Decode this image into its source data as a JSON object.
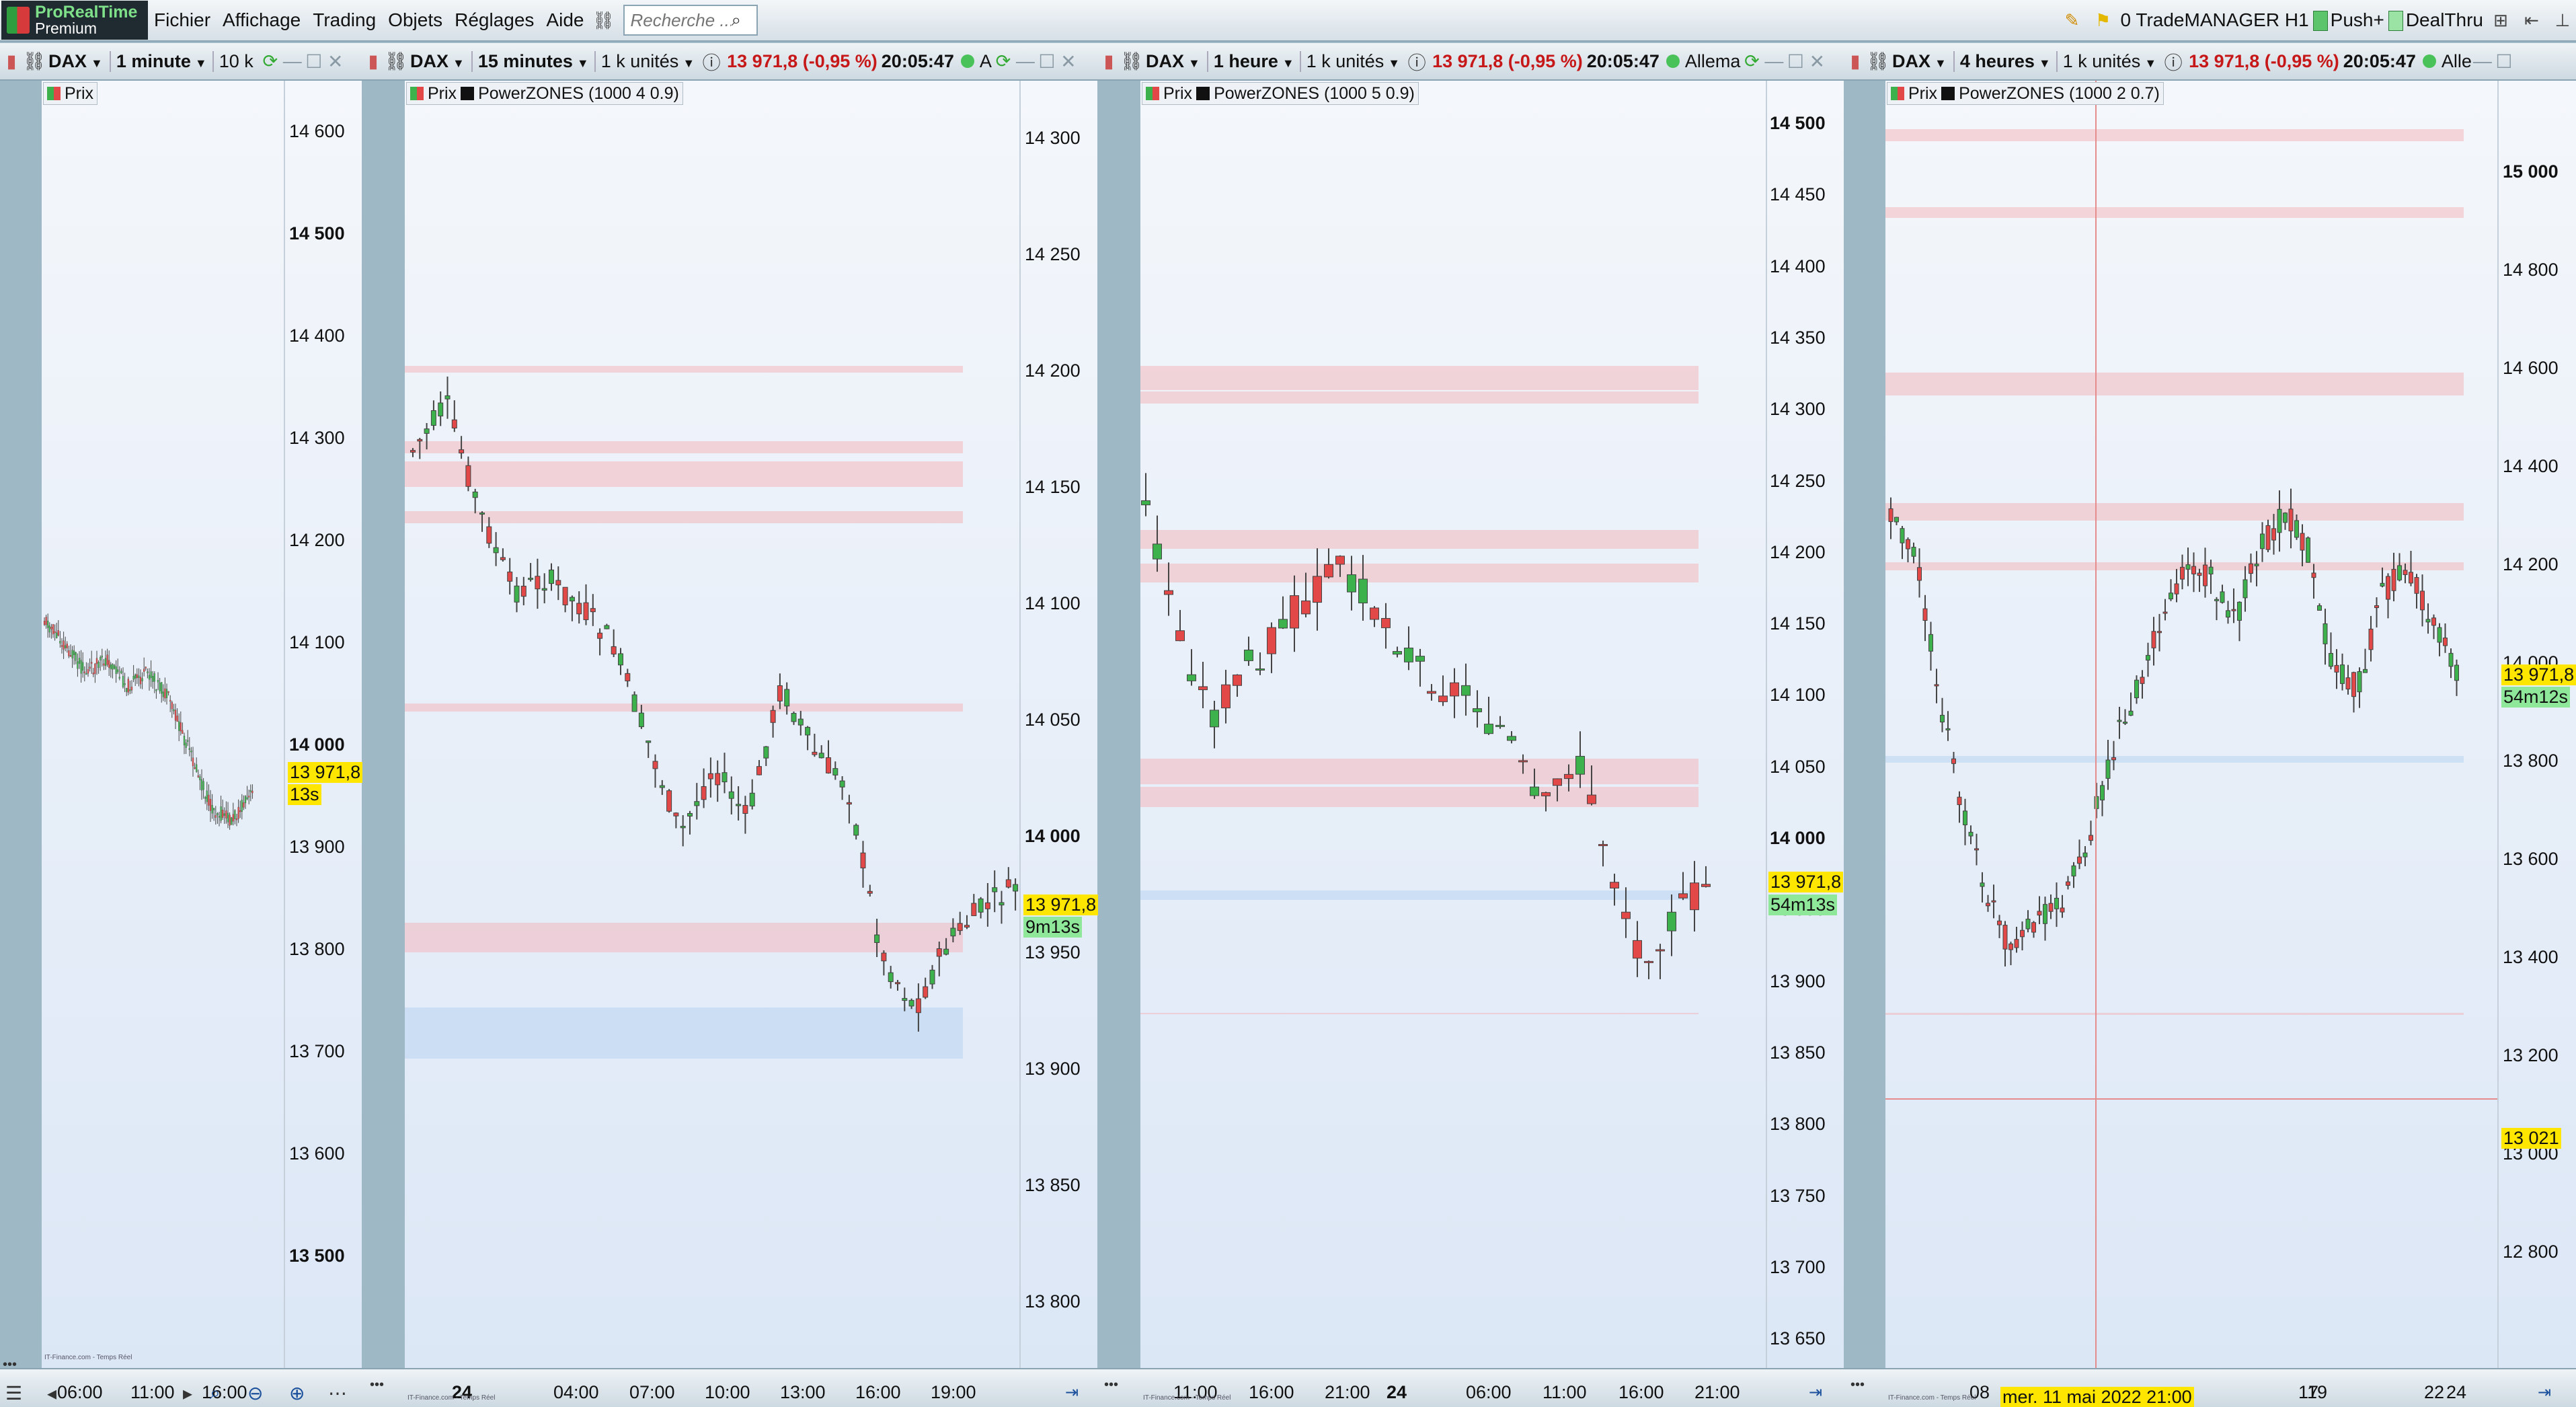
{
  "app": {
    "logo_line1": "ProRealTime",
    "logo_line2": "Premium"
  },
  "menu": [
    "Fichier",
    "Affichage",
    "Trading",
    "Objets",
    "Réglages",
    "Aide"
  ],
  "search": {
    "placeholder": "Recherche ..."
  },
  "topright": {
    "orders": "0 TradeMANAGER H1",
    "push": "Push+",
    "dealthru": "DealThru"
  },
  "source": "IT-Finance.com - Temps Réel",
  "panels": [
    {
      "symbol": "DAX",
      "timeframe": "1 minute",
      "units": "10 k",
      "legend": [
        "Prix"
      ],
      "yticks": [
        "14 600",
        "14 500",
        "14 400",
        "14 300",
        "14 200",
        "14 100",
        "14 000",
        "13 900",
        "13 800",
        "13 700",
        "13 600",
        "13 500"
      ],
      "price_label": "13 971,8",
      "countdown": "13s",
      "xticks": [
        "06:00",
        "11:00",
        "16:00"
      ]
    },
    {
      "symbol": "DAX",
      "timeframe": "15 minutes",
      "units": "1 k unités",
      "price": "13 971,8 (-0,95 %)",
      "time": "20:05:47",
      "market": "A",
      "legend": [
        "Prix",
        "PowerZONES (1000 4 0.9)"
      ],
      "yticks": [
        "14 300",
        "14 250",
        "14 200",
        "14 150",
        "14 100",
        "14 050",
        "14 000",
        "13 950",
        "13 900",
        "13 850",
        "13 800"
      ],
      "price_label": "13 971,8",
      "countdown": "9m13s",
      "xticks": [
        "24",
        "04:00",
        "07:00",
        "10:00",
        "13:00",
        "16:00",
        "19:00"
      ]
    },
    {
      "symbol": "DAX",
      "timeframe": "1 heure",
      "units": "1 k unités",
      "price": "13 971,8 (-0,95 %)",
      "time": "20:05:47",
      "market": "Allema",
      "legend": [
        "Prix",
        "PowerZONES (1000 5 0.9)"
      ],
      "yticks": [
        "14 500",
        "14 450",
        "14 400",
        "14 350",
        "14 300",
        "14 250",
        "14 200",
        "14 150",
        "14 100",
        "14 050",
        "14 000",
        "13 950",
        "13 900",
        "13 850",
        "13 800",
        "13 750",
        "13 700",
        "13 650"
      ],
      "price_label": "13 971,8",
      "countdown": "54m13s",
      "xticks": [
        "11:00",
        "16:00",
        "21:00",
        "24",
        "06:00",
        "11:00",
        "16:00",
        "21:00"
      ]
    },
    {
      "symbol": "DAX",
      "timeframe": "4 heures",
      "units": "1 k unités",
      "price": "13 971,8 (-0,95 %)",
      "time": "20:05:47",
      "market": "Alle",
      "legend": [
        "Prix",
        "PowerZONES (1000 2 0.7)"
      ],
      "yticks": [
        "15 000",
        "14 800",
        "14 600",
        "14 400",
        "14 200",
        "14 000",
        "13 800",
        "13 600",
        "13 400",
        "13 200",
        "13 000",
        "12 800"
      ],
      "price_label": "13 971,8",
      "countdown": "54m12s",
      "cursor_label": "13 021",
      "cursor_date": "mer. 11 mai 2022 21:00",
      "xticks": [
        "08",
        "17",
        "19",
        "22",
        "24"
      ]
    }
  ],
  "colors": {
    "up": "#3db24c",
    "down": "#e24848",
    "supply": "#f2b8bd",
    "demand": "#b8d4f0",
    "price": "#ffe600",
    "countdown": "#8fe89a"
  }
}
